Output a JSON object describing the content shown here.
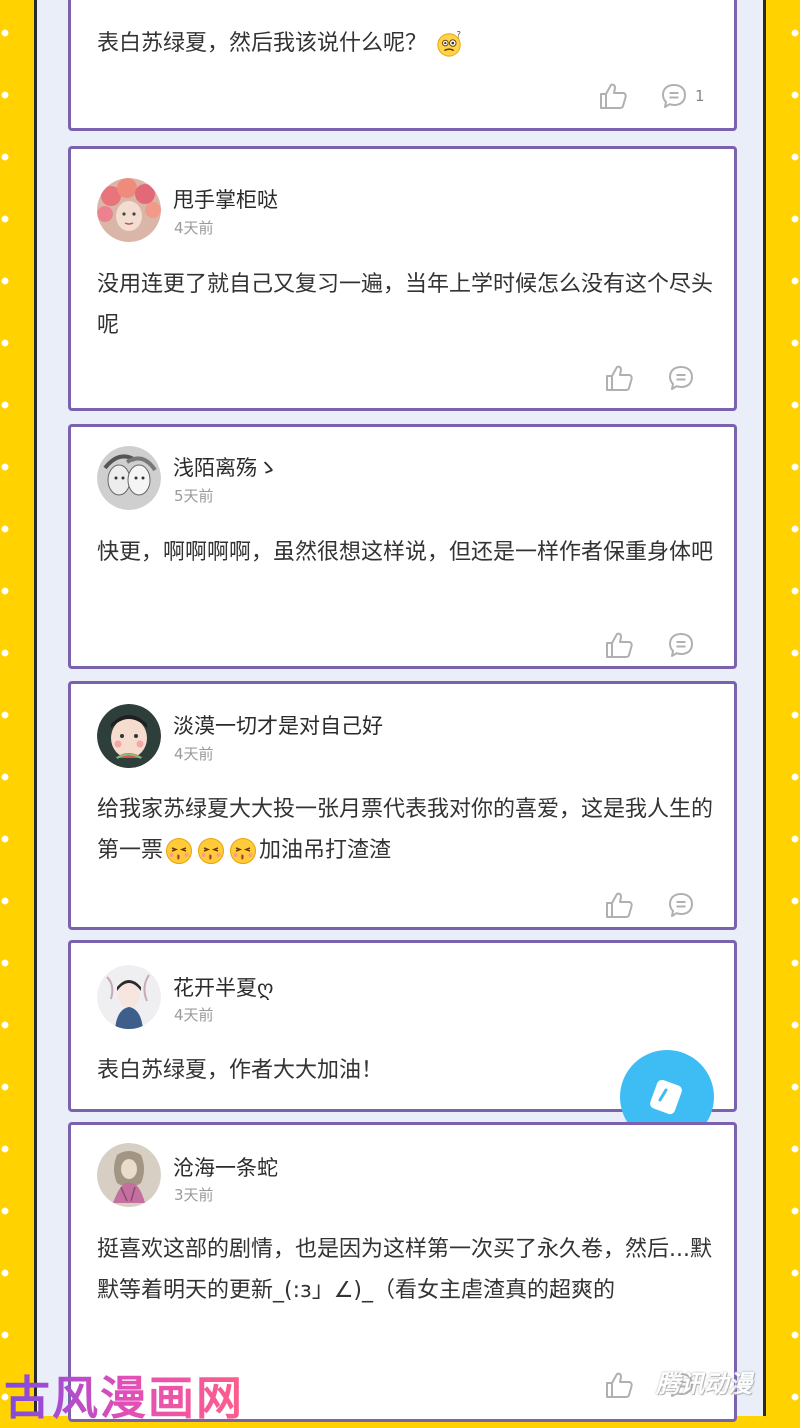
{
  "comments": [
    {
      "name": "",
      "time": "",
      "text": "表白苏绿夏，然后我该说什么呢？",
      "reply_count": "1"
    },
    {
      "name": "甩手掌柜哒",
      "time": "4天前",
      "text": "没用连更了就自己又复习一遍，当年上学时候怎么没有这个尽头呢",
      "reply_count": ""
    },
    {
      "name": "浅陌离殇ゝ",
      "time": "5天前",
      "text": "快更，啊啊啊啊，虽然很想这样说，但还是一样作者保重身体吧",
      "reply_count": ""
    },
    {
      "name": "淡漠一切才是对自己好",
      "time": "4天前",
      "text_a": "给我家苏绿夏大大投一张月票代表我对你的喜爱，这是我人生的第一票",
      "text_b": "加油吊打渣渣",
      "reply_count": ""
    },
    {
      "name": "花开半夏ღ",
      "time": "4天前",
      "text": "表白苏绿夏，作者大大加油！",
      "reply_count": ""
    },
    {
      "name": "沧海一条蛇",
      "time": "3天前",
      "text": "挺喜欢这部的剧情，也是因为这样第一次买了永久卷，然后...默默等着明天的更新_(:з」∠)_（看女主虐渣真的超爽的",
      "reply_count": ""
    }
  ],
  "watermark_left": "古风漫画网",
  "watermark_right": "腾讯动漫",
  "colors": {
    "background": "#FFD200",
    "card_border": "#7B62AE",
    "strip": "#E9EEF8",
    "fab": "#3DBDF4"
  },
  "icons": {
    "like": "thumbs-up-icon",
    "comment": "comment-bubble-icon",
    "emoji": "kissing-face-icon",
    "fab": "edit-icon"
  }
}
